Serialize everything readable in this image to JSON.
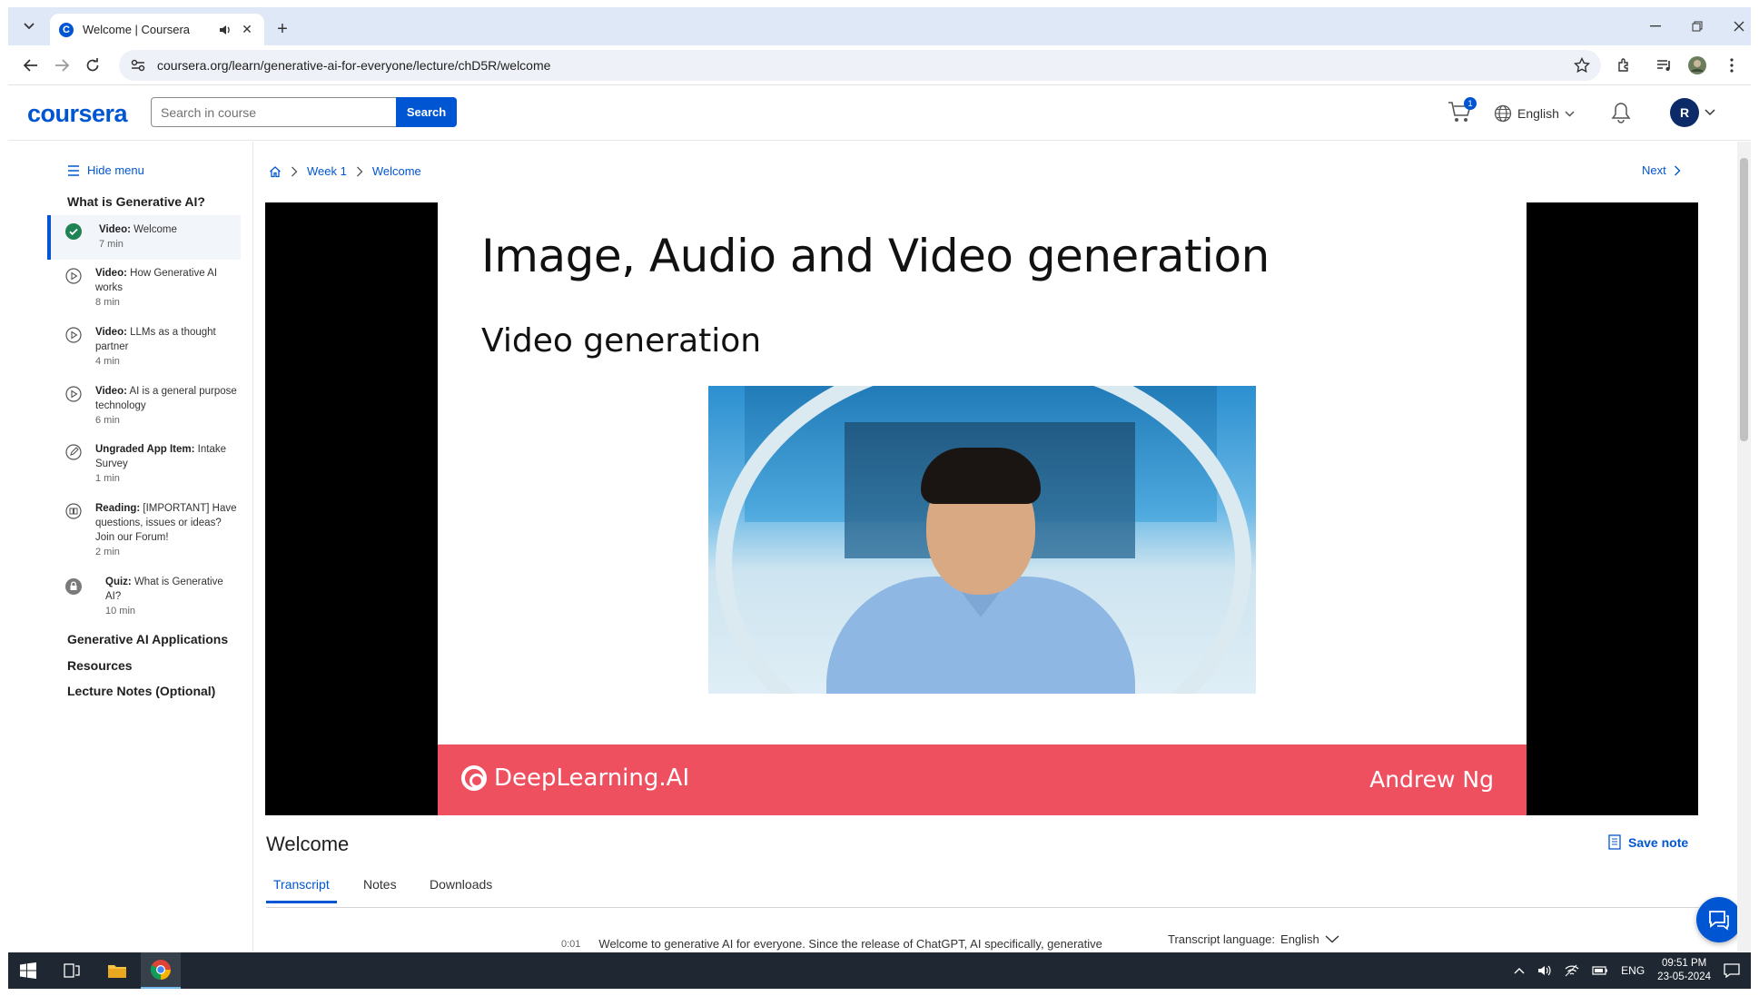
{
  "browser": {
    "tab_title": "Welcome | Coursera",
    "favicon_letter": "C",
    "url": "coursera.org/learn/generative-ai-for-everyone/lecture/chD5R/welcome"
  },
  "header": {
    "logo": "coursera",
    "search_placeholder": "Search in course",
    "search_button": "Search",
    "cart_count": "1",
    "language": "English",
    "avatar_initial": "R"
  },
  "sidebar": {
    "hide_menu": "Hide menu",
    "module_title": "What is Generative AI?",
    "items": [
      {
        "type": "Video:",
        "title": "Welcome",
        "duration": "7 min",
        "status": "completed"
      },
      {
        "type": "Video:",
        "title": "How Generative AI works",
        "duration": "8 min",
        "status": "video"
      },
      {
        "type": "Video:",
        "title": "LLMs as a thought partner",
        "duration": "4 min",
        "status": "video"
      },
      {
        "type": "Video:",
        "title": "AI is a general purpose technology",
        "duration": "6 min",
        "status": "video"
      },
      {
        "type": "Ungraded App Item:",
        "title": "Intake Survey",
        "duration": "1 min",
        "status": "app"
      },
      {
        "type": "Reading:",
        "title": "[IMPORTANT] Have questions, issues or ideas? Join our Forum!",
        "duration": "2 min",
        "status": "reading"
      },
      {
        "type": "Quiz:",
        "title": "What is Generative AI?",
        "duration": "10 min",
        "status": "locked"
      }
    ],
    "other_modules": [
      "Generative AI Applications",
      "Resources",
      "Lecture Notes (Optional)"
    ]
  },
  "breadcrumb": {
    "week": "Week 1",
    "current": "Welcome"
  },
  "next_label": "Next",
  "video": {
    "slide_title": "Image, Audio and Video generation",
    "slide_subtitle": "Video generation",
    "brand": "DeepLearning.AI",
    "presenter": "Andrew Ng",
    "band_color": "#ef5060"
  },
  "lecture": {
    "title": "Welcome",
    "save_note": "Save note",
    "tabs": [
      "Transcript",
      "Notes",
      "Downloads"
    ],
    "active_tab": "Transcript",
    "transcript_time": "0:01",
    "transcript_text": "Welcome to generative AI for everyone. Since the release of ChatGPT, AI specifically, generative",
    "transcript_language_label": "Transcript language:",
    "transcript_language": "English"
  },
  "taskbar": {
    "language": "ENG",
    "time": "09:51 PM",
    "date": "23-05-2024"
  },
  "colors": {
    "accent": "#0056d2",
    "taskbar": "#1f2832"
  }
}
